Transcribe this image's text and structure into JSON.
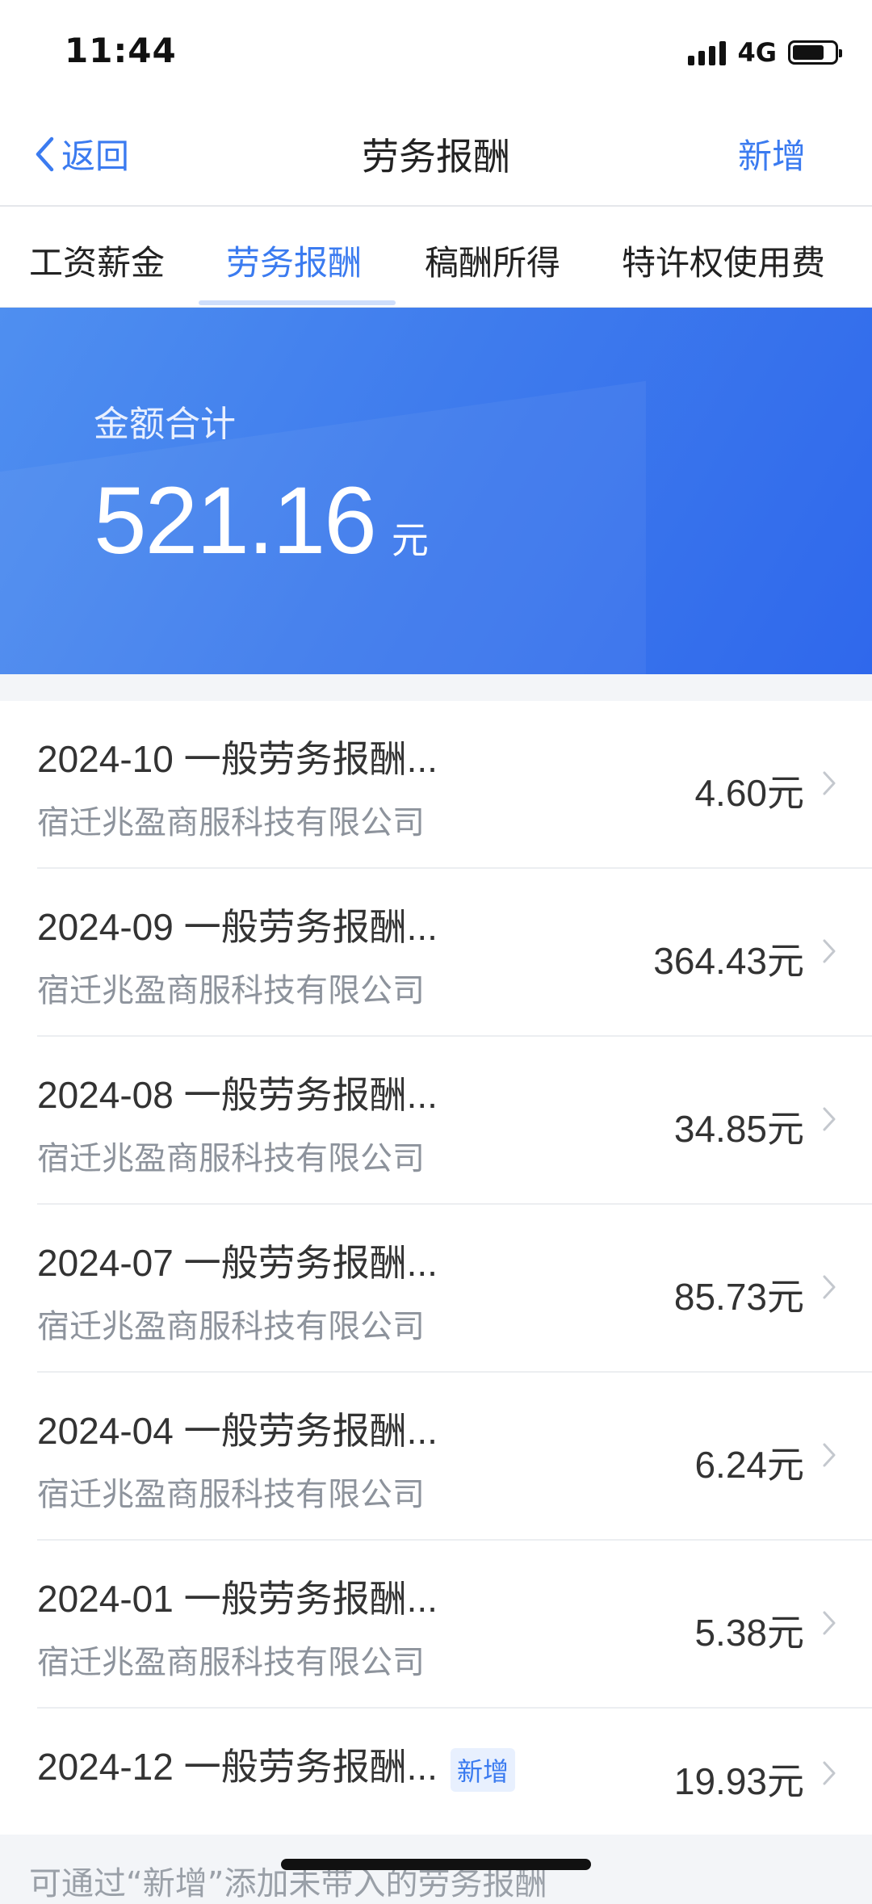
{
  "status": {
    "time": "11:44",
    "network": "4G"
  },
  "nav": {
    "back_label": "返回",
    "title": "劳务报酬",
    "action_label": "新增"
  },
  "tabs": [
    {
      "label": "工资薪金"
    },
    {
      "label": "劳务报酬",
      "active": true
    },
    {
      "label": "稿酬所得"
    },
    {
      "label": "特许权使用费"
    }
  ],
  "summary": {
    "label": "金额合计",
    "amount": "521.16",
    "unit": "元"
  },
  "records": [
    {
      "title": "2024-10 一般劳务报酬...",
      "company": "宿迁兆盈商服科技有限公司",
      "amount": "4.60元"
    },
    {
      "title": "2024-09 一般劳务报酬...",
      "company": "宿迁兆盈商服科技有限公司",
      "amount": "364.43元"
    },
    {
      "title": "2024-08 一般劳务报酬...",
      "company": "宿迁兆盈商服科技有限公司",
      "amount": "34.85元"
    },
    {
      "title": "2024-07 一般劳务报酬...",
      "company": "宿迁兆盈商服科技有限公司",
      "amount": "85.73元"
    },
    {
      "title": "2024-04 一般劳务报酬...",
      "company": "宿迁兆盈商服科技有限公司",
      "amount": "6.24元"
    },
    {
      "title": "2024-01 一般劳务报酬...",
      "company": "宿迁兆盈商服科技有限公司",
      "amount": "5.38元"
    },
    {
      "title": "2024-12 一般劳务报酬...",
      "badge": "新增",
      "amount": "19.93元"
    }
  ],
  "footer": {
    "hint": "可通过“新增”添加未带入的劳务报酬"
  },
  "colors": {
    "accent": "#3b7bf0",
    "banner_start": "#4f8ff0",
    "banner_end": "#2f68ec"
  }
}
